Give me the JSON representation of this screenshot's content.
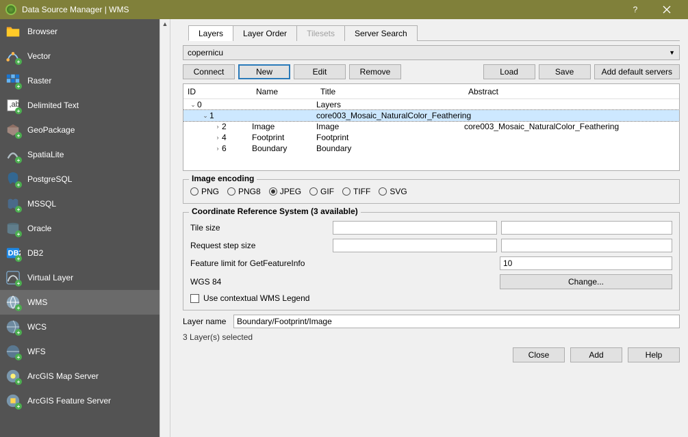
{
  "window": {
    "title": "Data Source Manager | WMS"
  },
  "sidebar": {
    "items": [
      {
        "label": "Browser"
      },
      {
        "label": "Vector"
      },
      {
        "label": "Raster"
      },
      {
        "label": "Delimited Text"
      },
      {
        "label": "GeoPackage"
      },
      {
        "label": "SpatiaLite"
      },
      {
        "label": "PostgreSQL"
      },
      {
        "label": "MSSQL"
      },
      {
        "label": "Oracle"
      },
      {
        "label": "DB2"
      },
      {
        "label": "Virtual Layer"
      },
      {
        "label": "WMS"
      },
      {
        "label": "WCS"
      },
      {
        "label": "WFS"
      },
      {
        "label": "ArcGIS Map Server"
      },
      {
        "label": "ArcGIS Feature Server"
      }
    ]
  },
  "tabs": {
    "layers": "Layers",
    "layer_order": "Layer Order",
    "tilesets": "Tilesets",
    "server_search": "Server Search"
  },
  "connection": {
    "selected": "copernicu"
  },
  "buttons": {
    "connect": "Connect",
    "new": "New",
    "edit": "Edit",
    "remove": "Remove",
    "load": "Load",
    "save": "Save",
    "add_default": "Add default servers",
    "change": "Change...",
    "close": "Close",
    "add": "Add",
    "help": "Help"
  },
  "tree": {
    "headers": {
      "id": "ID",
      "name": "Name",
      "title": "Title",
      "abstract": "Abstract"
    },
    "rows": [
      {
        "indent": 0,
        "exp": "v",
        "id": "0",
        "name": "",
        "title": "Layers",
        "abs": "",
        "sel": false
      },
      {
        "indent": 1,
        "exp": "v",
        "id": "1",
        "name": "",
        "title": "core003_Mosaic_NaturalColor_Feathering",
        "abs": "",
        "sel": true
      },
      {
        "indent": 2,
        "exp": ">",
        "id": "2",
        "name": "Image",
        "title": "Image",
        "abs": "core003_Mosaic_NaturalColor_Feathering",
        "sel": false
      },
      {
        "indent": 2,
        "exp": ">",
        "id": "4",
        "name": "Footprint",
        "title": "Footprint",
        "abs": "",
        "sel": false
      },
      {
        "indent": 2,
        "exp": ">",
        "id": "6",
        "name": "Boundary",
        "title": "Boundary",
        "abs": "",
        "sel": false
      }
    ]
  },
  "encoding": {
    "title": "Image encoding",
    "options": [
      "PNG",
      "PNG8",
      "JPEG",
      "GIF",
      "TIFF",
      "SVG"
    ],
    "selected": "JPEG"
  },
  "crs": {
    "title": "Coordinate Reference System (3 available)",
    "tile_size_label": "Tile size",
    "step_size_label": "Request step size",
    "feature_limit_label": "Feature limit for GetFeatureInfo",
    "feature_limit_value": "10",
    "crs_label": "WGS 84",
    "legend_label": "Use contextual WMS Legend"
  },
  "layer_name": {
    "label": "Layer name",
    "value": "Boundary/Footprint/Image"
  },
  "status": "3 Layer(s) selected"
}
